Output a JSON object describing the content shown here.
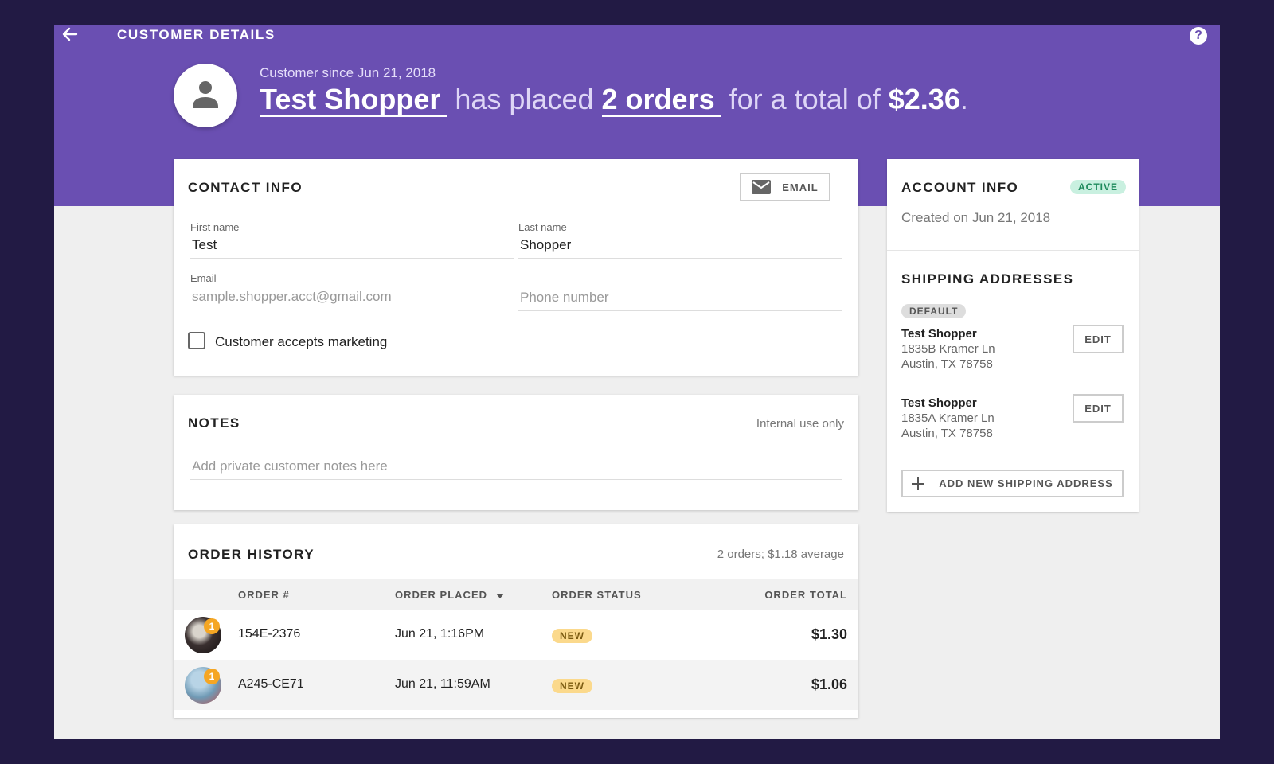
{
  "header": {
    "title": "CUSTOMER DETAILS",
    "since": "Customer since Jun 21, 2018",
    "name": "Test Shopper",
    "has_placed": "has placed",
    "orders_link": "2 orders",
    "for_total": "for a total of",
    "total": "$2.36",
    "period": "."
  },
  "contact": {
    "title": "CONTACT INFO",
    "email_button": "EMAIL",
    "first_name_label": "First name",
    "first_name": "Test",
    "last_name_label": "Last name",
    "last_name": "Shopper",
    "email_label": "Email",
    "email": "sample.shopper.acct@gmail.com",
    "phone_placeholder": "Phone number",
    "marketing_label": "Customer accepts marketing"
  },
  "notes": {
    "title": "NOTES",
    "hint": "Internal use only",
    "placeholder": "Add private customer notes here"
  },
  "orders": {
    "title": "ORDER HISTORY",
    "summary": "2 orders; $1.18 average",
    "headers": {
      "number": "ORDER #",
      "placed": "ORDER PLACED",
      "status": "ORDER STATUS",
      "total": "ORDER TOTAL"
    },
    "rows": [
      {
        "qty": "1",
        "number": "154E-2376",
        "placed": "Jun 21, 1:16PM",
        "status": "NEW",
        "total": "$1.30"
      },
      {
        "qty": "1",
        "number": "A245-CE71",
        "placed": "Jun 21, 11:59AM",
        "status": "NEW",
        "total": "$1.06"
      }
    ]
  },
  "account": {
    "title": "ACCOUNT INFO",
    "status": "ACTIVE",
    "created": "Created on Jun 21, 2018"
  },
  "shipping": {
    "title": "SHIPPING ADDRESSES",
    "default_badge": "DEFAULT",
    "edit_label": "EDIT",
    "addresses": [
      {
        "name": "Test Shopper",
        "line1": "1835B Kramer Ln",
        "line2": "Austin, TX 78758"
      },
      {
        "name": "Test Shopper",
        "line1": "1835A Kramer Ln",
        "line2": "Austin, TX 78758"
      }
    ],
    "add_button": "ADD NEW SHIPPING ADDRESS"
  },
  "colors": {
    "brand": "#6a4fb2",
    "background": "#221a44",
    "active_badge": "#c9f0e0",
    "new_badge": "#fbd98c"
  }
}
